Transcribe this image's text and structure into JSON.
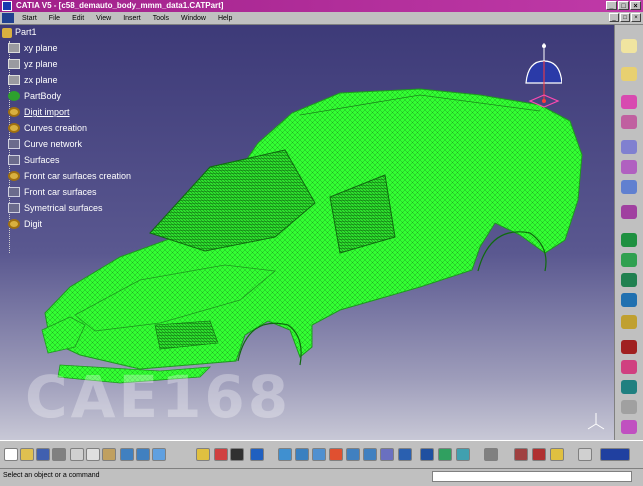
{
  "window": {
    "title": "CATIA V5 - [c58_demauto_body_mmm_data1.CATPart]",
    "controls": [
      "_",
      "□",
      "×"
    ]
  },
  "menu": {
    "items": [
      "Start",
      "File",
      "Edit",
      "View",
      "Insert",
      "Tools",
      "Window",
      "Help"
    ]
  },
  "tree": {
    "root": "Part1",
    "items": [
      {
        "label": "xy plane",
        "icon": "plane-icon"
      },
      {
        "label": "yz plane",
        "icon": "plane-icon"
      },
      {
        "label": "zx plane",
        "icon": "plane-icon"
      },
      {
        "label": "PartBody",
        "icon": "body-icon"
      },
      {
        "label": "Digit import",
        "icon": "gear-icon"
      },
      {
        "label": "Curves creation",
        "icon": "gear-icon"
      },
      {
        "label": "Curve network",
        "icon": "geometrical-set-icon"
      },
      {
        "label": "Surfaces",
        "icon": "geometrical-set-icon"
      },
      {
        "label": "Front car surfaces creation",
        "icon": "gear-icon"
      },
      {
        "label": "Front car surfaces",
        "icon": "geometrical-set-icon"
      },
      {
        "label": "Symetrical surfaces",
        "icon": "geometrical-set-icon"
      },
      {
        "label": "Digit",
        "icon": "gear-icon"
      }
    ]
  },
  "viewport": {
    "watermark": "CAE168",
    "model_color": "#33ff33"
  },
  "status": {
    "message": "Select an object or a command"
  }
}
